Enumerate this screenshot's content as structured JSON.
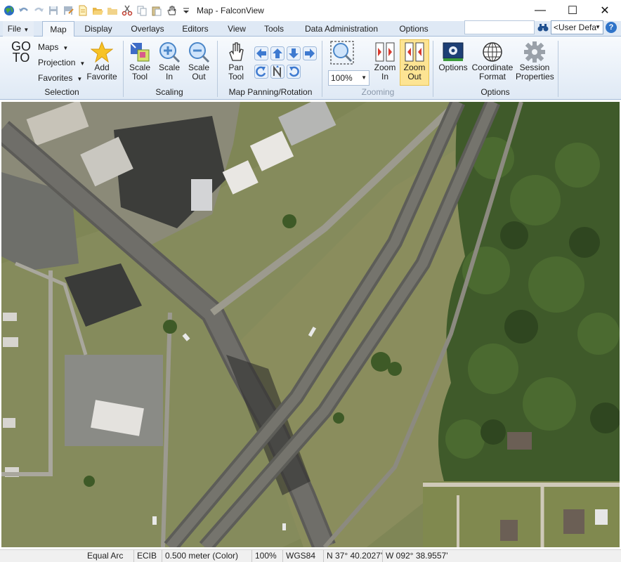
{
  "window": {
    "title": "Map - FalconView",
    "controls": {
      "minimize": "—",
      "maximize": "☐",
      "close": "✕"
    }
  },
  "quick_access": {
    "icons": [
      "globe-icon",
      "undo-icon",
      "redo-icon",
      "save-icon",
      "save-as-icon",
      "new-document-icon",
      "open-folder-icon",
      "folder-icon",
      "cut-icon",
      "copy-icon",
      "paste-icon",
      "hand-icon",
      "customize-dropdown-icon"
    ]
  },
  "tabs": {
    "file": "File",
    "map": "Map",
    "display": "Display",
    "overlays": "Overlays",
    "editors": "Editors",
    "view": "View",
    "tools": "Tools",
    "data_admin": "Data Administration",
    "options": "Options"
  },
  "tab_tools": {
    "search_value": "",
    "user_select": "<User Defa",
    "help": "?"
  },
  "ribbon": {
    "selection": {
      "goto_line1": "GO",
      "goto_line2": "TO",
      "maps": "Maps",
      "projection": "Projection",
      "favorites": "Favorites",
      "add_favorite_line1": "Add",
      "add_favorite_line2": "Favorite",
      "label": "Selection"
    },
    "scaling": {
      "scale_tool_line1": "Scale",
      "scale_tool_line2": "Tool",
      "scale_in_line1": "Scale",
      "scale_in_line2": "In",
      "scale_out_line1": "Scale",
      "scale_out_line2": "Out",
      "label": "Scaling"
    },
    "panning": {
      "pan_line1": "Pan",
      "pan_line2": "Tool",
      "label": "Map Panning/Rotation"
    },
    "zooming": {
      "zoom_value": "100%",
      "zoom_in_line1": "Zoom",
      "zoom_in_line2": "In",
      "zoom_out_line1": "Zoom",
      "zoom_out_line2": "Out",
      "label": "Zooming"
    },
    "options": {
      "options_label": "Options",
      "coord_line1": "Coordinate",
      "coord_line2": "Format",
      "session_line1": "Session",
      "session_line2": "Properties",
      "label": "Options"
    }
  },
  "status": {
    "projection": "Equal Arc",
    "map_type": "ECIB",
    "resolution": "0.500 meter (Color)",
    "zoom": "100%",
    "datum": "WGS84",
    "latitude": "N  37° 40.2027'",
    "longitude": "W  092° 38.9557'"
  },
  "colors": {
    "ribbon_bg": "#dfe9f5",
    "active_button": "#fde493",
    "accent_blue": "#2f74c9"
  }
}
